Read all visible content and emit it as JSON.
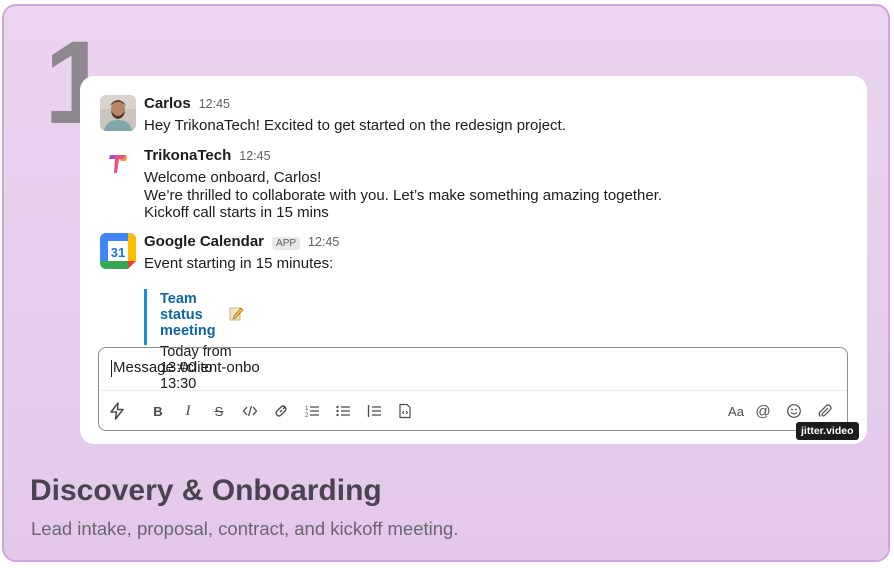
{
  "step_number": "1",
  "messages": [
    {
      "name": "Carlos",
      "time": "12:45",
      "lines": [
        "Hey TrikonaTech! Excited to get started on the redesign project."
      ]
    },
    {
      "name": "TrikonaTech",
      "time": "12:45",
      "lines": [
        "Welcome onboard, Carlos!",
        "We’re thrilled to collaborate with you. Let’s make something amazing together.",
        "Kickoff call starts in 15 mins"
      ]
    },
    {
      "name": "Google Calendar",
      "badge": "APP",
      "time": "12:45",
      "lines": [
        "Event starting in 15 minutes:"
      ],
      "calendar_icon_text": "31",
      "event": {
        "title": "Team status meeting",
        "time": "Today from 13:00 to 13:30"
      }
    }
  ],
  "composer": {
    "value": "Message #client-onbo"
  },
  "toolbar_icons": [
    "shortcuts-icon",
    "bold-icon",
    "italic-icon",
    "strikethrough-icon",
    "code-icon",
    "link-icon",
    "ordered-list-icon",
    "bullet-list-icon",
    "numbered-list-icon",
    "code-block-icon",
    "formatting-icon",
    "mention-icon",
    "emoji-icon",
    "attach-icon"
  ],
  "toolbar_glyphs": {
    "bold": "B",
    "italic": "I",
    "strike": "S",
    "formatting": "Aa",
    "mention": "@"
  },
  "watermark": "jitter.video",
  "footer": {
    "title": "Discovery & Onboarding",
    "subtitle": "Lead intake, proposal, contract, and kickoff meeting."
  },
  "colors": {
    "background": "#e6cdec",
    "border": "#cfa6dc",
    "link": "#1264a3",
    "quote_bar": "#1a8fd6"
  }
}
